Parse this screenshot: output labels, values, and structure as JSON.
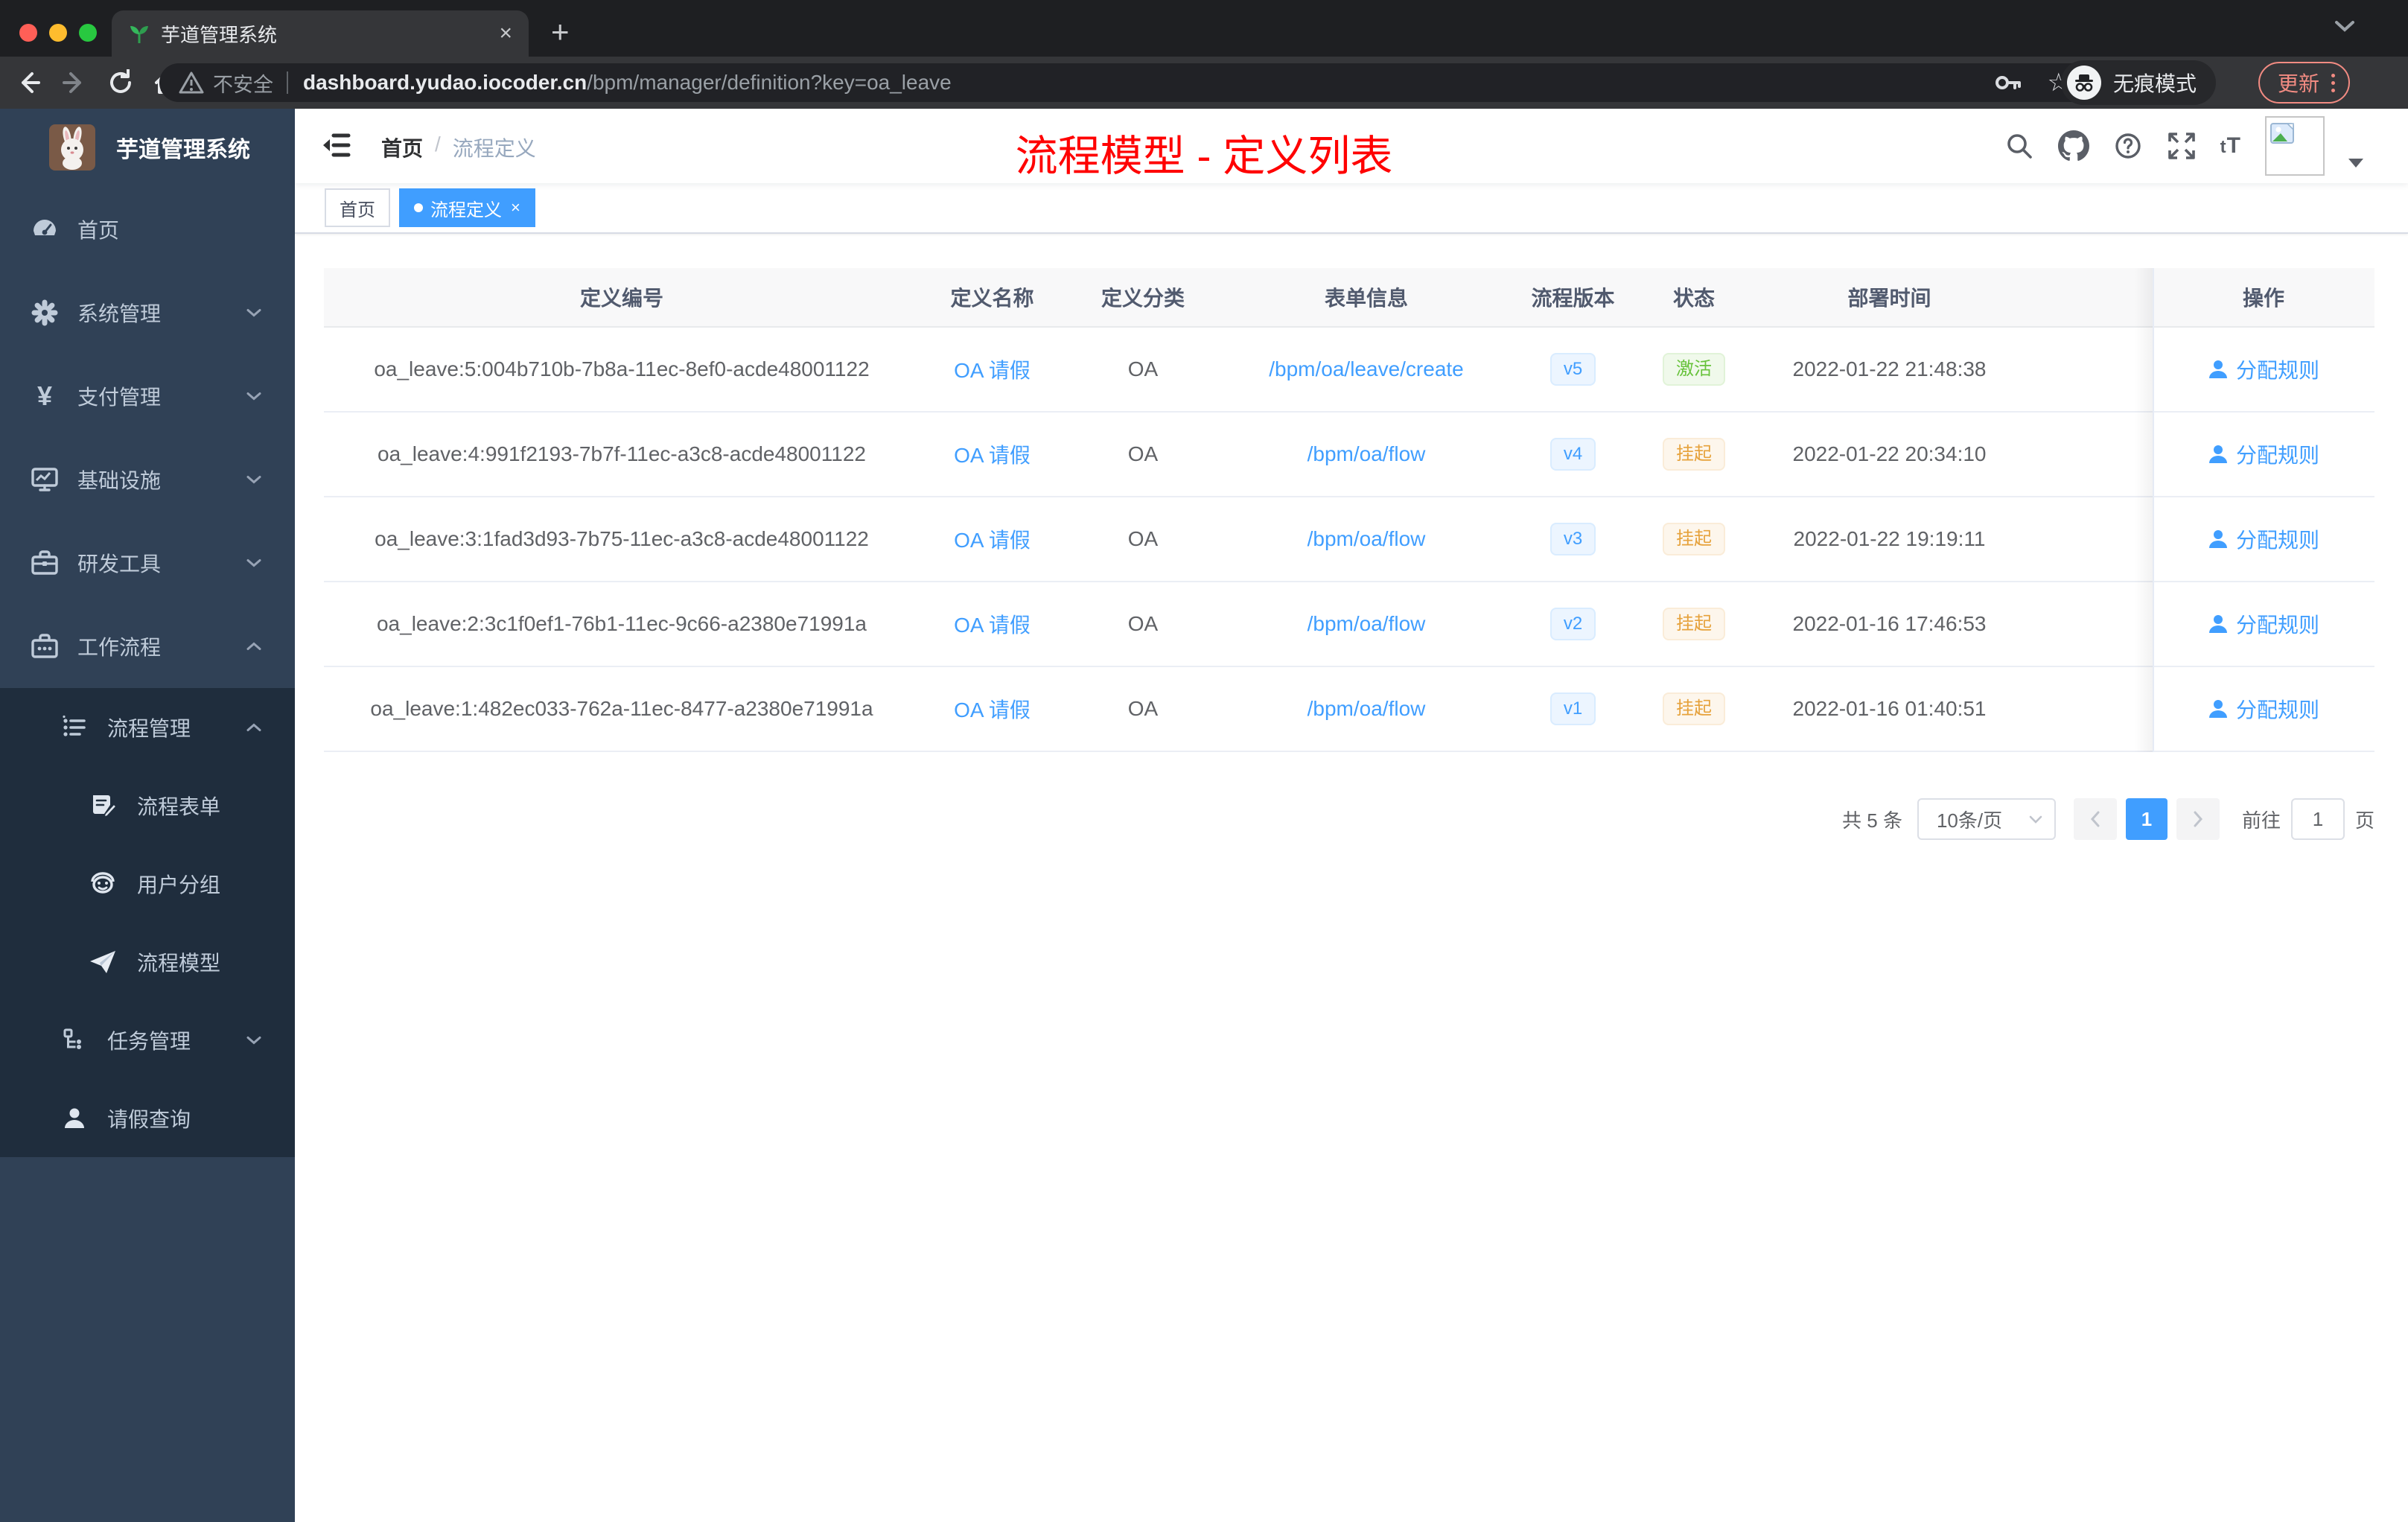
{
  "browser": {
    "tab_title": "芋道管理系统",
    "security_label": "不安全",
    "url_host": "dashboard.yudao.iocoder.cn",
    "url_path": "/bpm/manager/definition?key=oa_leave",
    "incognito_label": "无痕模式",
    "update_label": "更新"
  },
  "sidebar": {
    "title": "芋道管理系统",
    "items": [
      {
        "label": "首页",
        "icon": "dashboard-icon"
      },
      {
        "label": "系统管理",
        "icon": "gear-icon",
        "chevron": "down"
      },
      {
        "label": "支付管理",
        "icon": "yen-icon",
        "chevron": "down",
        "icon_glyph": "¥"
      },
      {
        "label": "基础设施",
        "icon": "monitor-icon",
        "chevron": "down"
      },
      {
        "label": "研发工具",
        "icon": "toolbox-icon",
        "chevron": "down"
      },
      {
        "label": "工作流程",
        "icon": "workflow-icon",
        "chevron": "up"
      },
      {
        "label": "流程管理",
        "icon": "process-list-icon",
        "chevron": "up"
      },
      {
        "label": "流程表单",
        "icon": "form-icon"
      },
      {
        "label": "用户分组",
        "icon": "user-group-icon"
      },
      {
        "label": "流程模型",
        "icon": "paper-plane-icon"
      },
      {
        "label": "任务管理",
        "icon": "task-tree-icon",
        "chevron": "down"
      },
      {
        "label": "请假查询",
        "icon": "person-icon"
      }
    ]
  },
  "navbar": {
    "breadcrumb": {
      "home": "首页",
      "separator": "/",
      "current": "流程定义"
    },
    "annotation": "流程模型 - 定义列表",
    "font_icon_label": "tT"
  },
  "tags": [
    {
      "label": "首页",
      "active": false
    },
    {
      "label": "流程定义",
      "active": true
    }
  ],
  "table": {
    "headers": [
      "定义编号",
      "定义名称",
      "定义分类",
      "表单信息",
      "流程版本",
      "状态",
      "部署时间",
      "操作"
    ],
    "action_label": "分配规则",
    "rows": [
      {
        "id": "oa_leave:5:004b710b-7b8a-11ec-8ef0-acde48001122",
        "name": "OA 请假",
        "category": "OA",
        "form": "/bpm/oa/leave/create",
        "version": "v5",
        "status": "激活",
        "status_type": "active",
        "time": "2022-01-22 21:48:38"
      },
      {
        "id": "oa_leave:4:991f2193-7b7f-11ec-a3c8-acde48001122",
        "name": "OA 请假",
        "category": "OA",
        "form": "/bpm/oa/flow",
        "version": "v4",
        "status": "挂起",
        "status_type": "suspended",
        "time": "2022-01-22 20:34:10"
      },
      {
        "id": "oa_leave:3:1fad3d93-7b75-11ec-a3c8-acde48001122",
        "name": "OA 请假",
        "category": "OA",
        "form": "/bpm/oa/flow",
        "version": "v3",
        "status": "挂起",
        "status_type": "suspended",
        "time": "2022-01-22 19:19:11"
      },
      {
        "id": "oa_leave:2:3c1f0ef1-76b1-11ec-9c66-a2380e71991a",
        "name": "OA 请假",
        "category": "OA",
        "form": "/bpm/oa/flow",
        "version": "v2",
        "status": "挂起",
        "status_type": "suspended",
        "time": "2022-01-16 17:46:53"
      },
      {
        "id": "oa_leave:1:482ec033-762a-11ec-8477-a2380e71991a",
        "name": "OA 请假",
        "category": "OA",
        "form": "/bpm/oa/flow",
        "version": "v1",
        "status": "挂起",
        "status_type": "suspended",
        "time": "2022-01-16 01:40:51"
      }
    ]
  },
  "pagination": {
    "total": "共 5 条",
    "page_size": "10条/页",
    "current_page": "1",
    "goto_label": "前往",
    "goto_value": "1",
    "page_unit": "页"
  },
  "colors": {
    "accent": "#409eff",
    "status_active": "#67c23a",
    "status_suspended": "#e6a23c",
    "annotation": "#ff0000",
    "sidebar_bg": "#304156",
    "submenu_bg": "#1f2d3d"
  }
}
